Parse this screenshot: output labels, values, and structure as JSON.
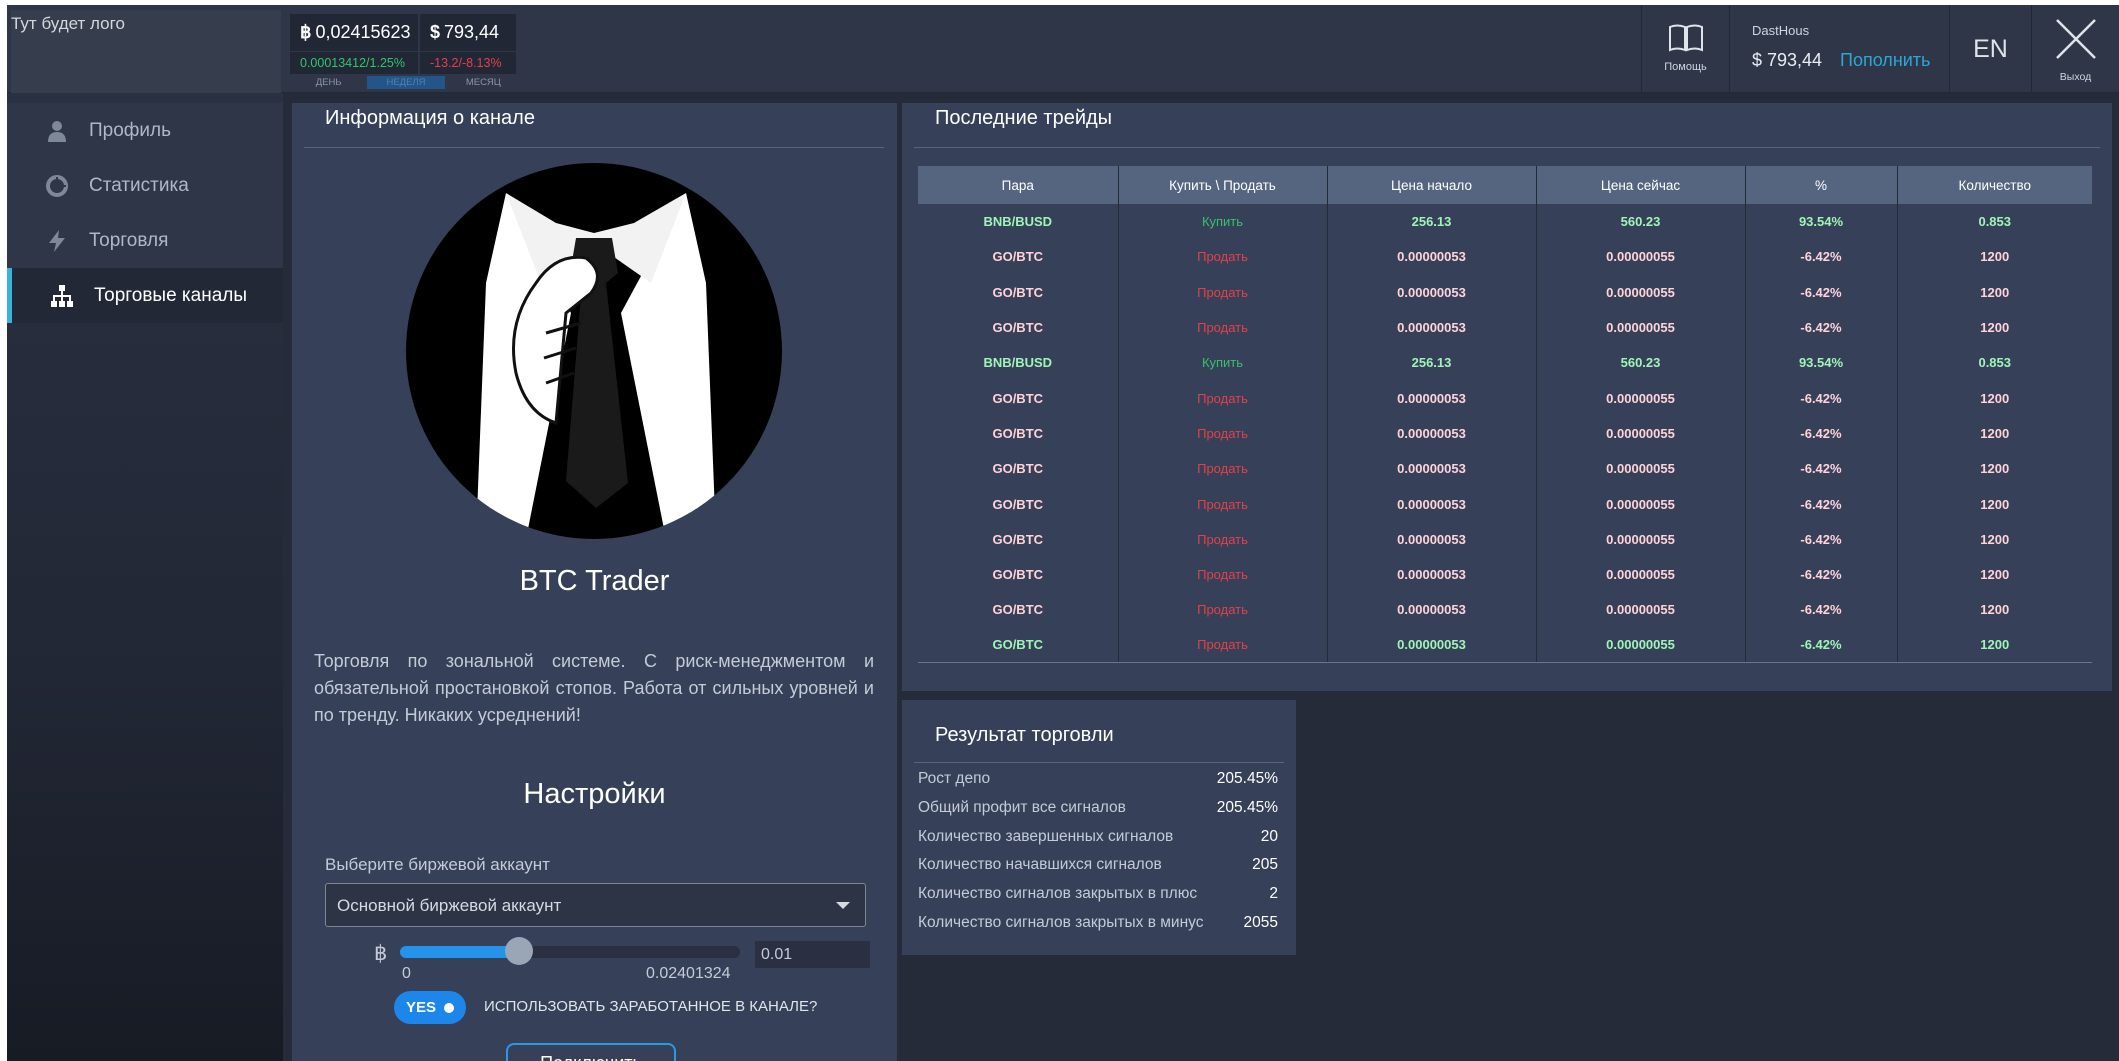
{
  "logo_text": "Тут будет лого",
  "ticker": {
    "btc_symbol": "฿",
    "btc_value": "0,02415623",
    "usd_symbol": "$",
    "usd_value": "793,44",
    "btc_change": "0.00013412/1.25%",
    "usd_change": "-13.2/-8.13%",
    "periods": [
      "ДЕНЬ",
      "НЕДЕЛЯ",
      "МЕСЯЦ"
    ],
    "active_period": "НЕДЕЛЯ"
  },
  "topbar": {
    "help_label": "Помощь",
    "help_icon": "book-icon",
    "username": "DastHous",
    "balance": "$ 793,44",
    "topup_label": "Пополнить",
    "language": "EN",
    "exit_label": "Выход",
    "exit_icon": "close-icon"
  },
  "sidebar": {
    "items": [
      {
        "label": "Профиль",
        "icon": "user-icon"
      },
      {
        "label": "Статистика",
        "icon": "pie-chart-icon"
      },
      {
        "label": "Торговля",
        "icon": "bolt-icon"
      },
      {
        "label": "Торговые каналы",
        "icon": "hierarchy-icon",
        "active": true
      }
    ]
  },
  "channel": {
    "title": "Информация о канале",
    "trader_name": "BTC Trader",
    "description": "Торговля по зональной системе. С риск-менеджментом и обязательной простановкой стопов. Работа от сильных уровней и по тренду. Никаких усреднений!",
    "settings_title": "Настройки",
    "account_label": "Выберите биржевой аккаунт",
    "account_selected": "Основной биржевой аккаунт",
    "slider_symbol": "฿",
    "slider_min": "0",
    "slider_max": "0.02401324",
    "slider_fraction": 0.35,
    "amount_value": "0.01",
    "toggle_label": "YES",
    "toggle_text": "ИСПОЛЬЗОВАТЬ ЗАРАБОТАННОЕ В КАНАЛЕ?",
    "connect_label": "Подключить"
  },
  "trades": {
    "title": "Последние трейды",
    "columns": [
      "Пара",
      "Купить \\ Продать",
      "Цена начало",
      "Цена сейчас",
      "%",
      "Количество"
    ],
    "rows": [
      [
        "BNB/BUSD",
        "Купить",
        "256.13",
        "560.23",
        "93.54%",
        "0.853"
      ],
      [
        "GO/BTC",
        "Продать",
        "0.00000053",
        "0.00000055",
        "-6.42%",
        "1200"
      ],
      [
        "GO/BTC",
        "Продать",
        "0.00000053",
        "0.00000055",
        "-6.42%",
        "1200"
      ],
      [
        "GO/BTC",
        "Продать",
        "0.00000053",
        "0.00000055",
        "-6.42%",
        "1200"
      ],
      [
        "BNB/BUSD",
        "Купить",
        "256.13",
        "560.23",
        "93.54%",
        "0.853"
      ],
      [
        "GO/BTC",
        "Продать",
        "0.00000053",
        "0.00000055",
        "-6.42%",
        "1200"
      ],
      [
        "GO/BTC",
        "Продать",
        "0.00000053",
        "0.00000055",
        "-6.42%",
        "1200"
      ],
      [
        "GO/BTC",
        "Продать",
        "0.00000053",
        "0.00000055",
        "-6.42%",
        "1200"
      ],
      [
        "GO/BTC",
        "Продать",
        "0.00000053",
        "0.00000055",
        "-6.42%",
        "1200"
      ],
      [
        "GO/BTC",
        "Продать",
        "0.00000053",
        "0.00000055",
        "-6.42%",
        "1200"
      ],
      [
        "GO/BTC",
        "Продать",
        "0.00000053",
        "0.00000055",
        "-6.42%",
        "1200"
      ],
      [
        "GO/BTC",
        "Продать",
        "0.00000053",
        "0.00000055",
        "-6.42%",
        "1200"
      ],
      [
        "GO/BTC",
        "Продать",
        "0.00000053",
        "0.00000055",
        "-6.42%",
        "1200"
      ]
    ]
  },
  "result": {
    "title": "Результат торговли",
    "rows": [
      {
        "label": "Рост депо",
        "value": "205.45%"
      },
      {
        "label": "Общий профит все сигналов",
        "value": "205.45%"
      },
      {
        "label": "Количество завершенных сигналов",
        "value": "20"
      },
      {
        "label": "Количество начавшихся сигналов",
        "value": "205"
      },
      {
        "label": "Количество сигналов закрытых в плюс",
        "value": "2"
      },
      {
        "label": "Количество сигналов закрытых в минус",
        "value": "2055"
      }
    ]
  },
  "colors": {
    "accent": "#2aa8d6",
    "buy": "#35c36a",
    "sell": "#e2404b",
    "toggle": "#1d86ea"
  }
}
